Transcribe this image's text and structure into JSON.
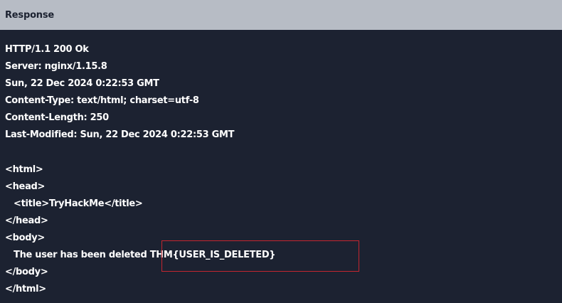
{
  "panel": {
    "title": "Response"
  },
  "headers": [
    "HTTP/1.1 200 Ok",
    "Server: nginx/1.15.8",
    "Sun, 22 Dec 2024 0:22:53 GMT",
    "Content-Type: text/html; charset=utf-8",
    "Content-Length: 250",
    "Last-Modified: Sun, 22 Dec 2024 0:22:53 GMT"
  ],
  "html_body": {
    "open_html": "<html>",
    "open_head": "<head>",
    "title_line": "<title>TryHackMe</title>",
    "close_head": "</head>",
    "open_body": "<body>",
    "message": "The user has been deleted ",
    "flag": "THM{USER_IS_DELETED}",
    "close_body": "</body>",
    "close_html": "</html>"
  },
  "colors": {
    "background": "#1c2231",
    "header_bar": "#b7bcc5",
    "text": "#ffffff",
    "highlight_box": "#c4262f"
  }
}
